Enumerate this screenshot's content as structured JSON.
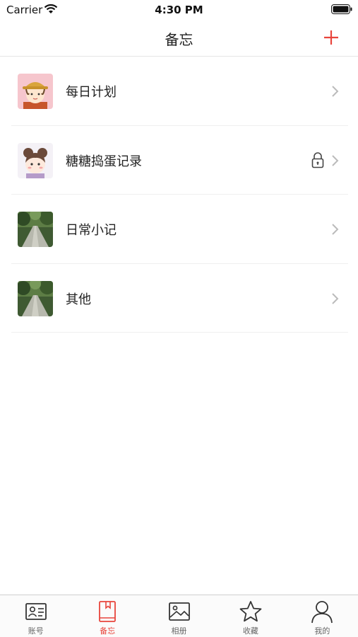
{
  "status_bar": {
    "carrier": "Carrier",
    "time": "4:30 PM"
  },
  "nav": {
    "title": "备忘",
    "add_icon": "plus-icon"
  },
  "colors": {
    "accent": "#e8453c",
    "text": "#222222",
    "icon": "#333333",
    "chevron": "#bbbbbb"
  },
  "list": {
    "items": [
      {
        "label": "每日计划",
        "thumb": "cartoon-girl-hat-avatar",
        "locked": false
      },
      {
        "label": "糖糖捣蛋记录",
        "thumb": "cartoon-child-avatar",
        "locked": true
      },
      {
        "label": "日常小记",
        "thumb": "forest-path-photo",
        "locked": false
      },
      {
        "label": "其他",
        "thumb": "forest-path-photo",
        "locked": false
      }
    ]
  },
  "tab_bar": {
    "tabs": [
      {
        "label": "账号",
        "icon": "id-card-icon",
        "active": false
      },
      {
        "label": "备忘",
        "icon": "notebook-icon",
        "active": true
      },
      {
        "label": "相册",
        "icon": "photo-icon",
        "active": false
      },
      {
        "label": "收藏",
        "icon": "star-icon",
        "active": false
      },
      {
        "label": "我的",
        "icon": "person-icon",
        "active": false
      }
    ]
  }
}
